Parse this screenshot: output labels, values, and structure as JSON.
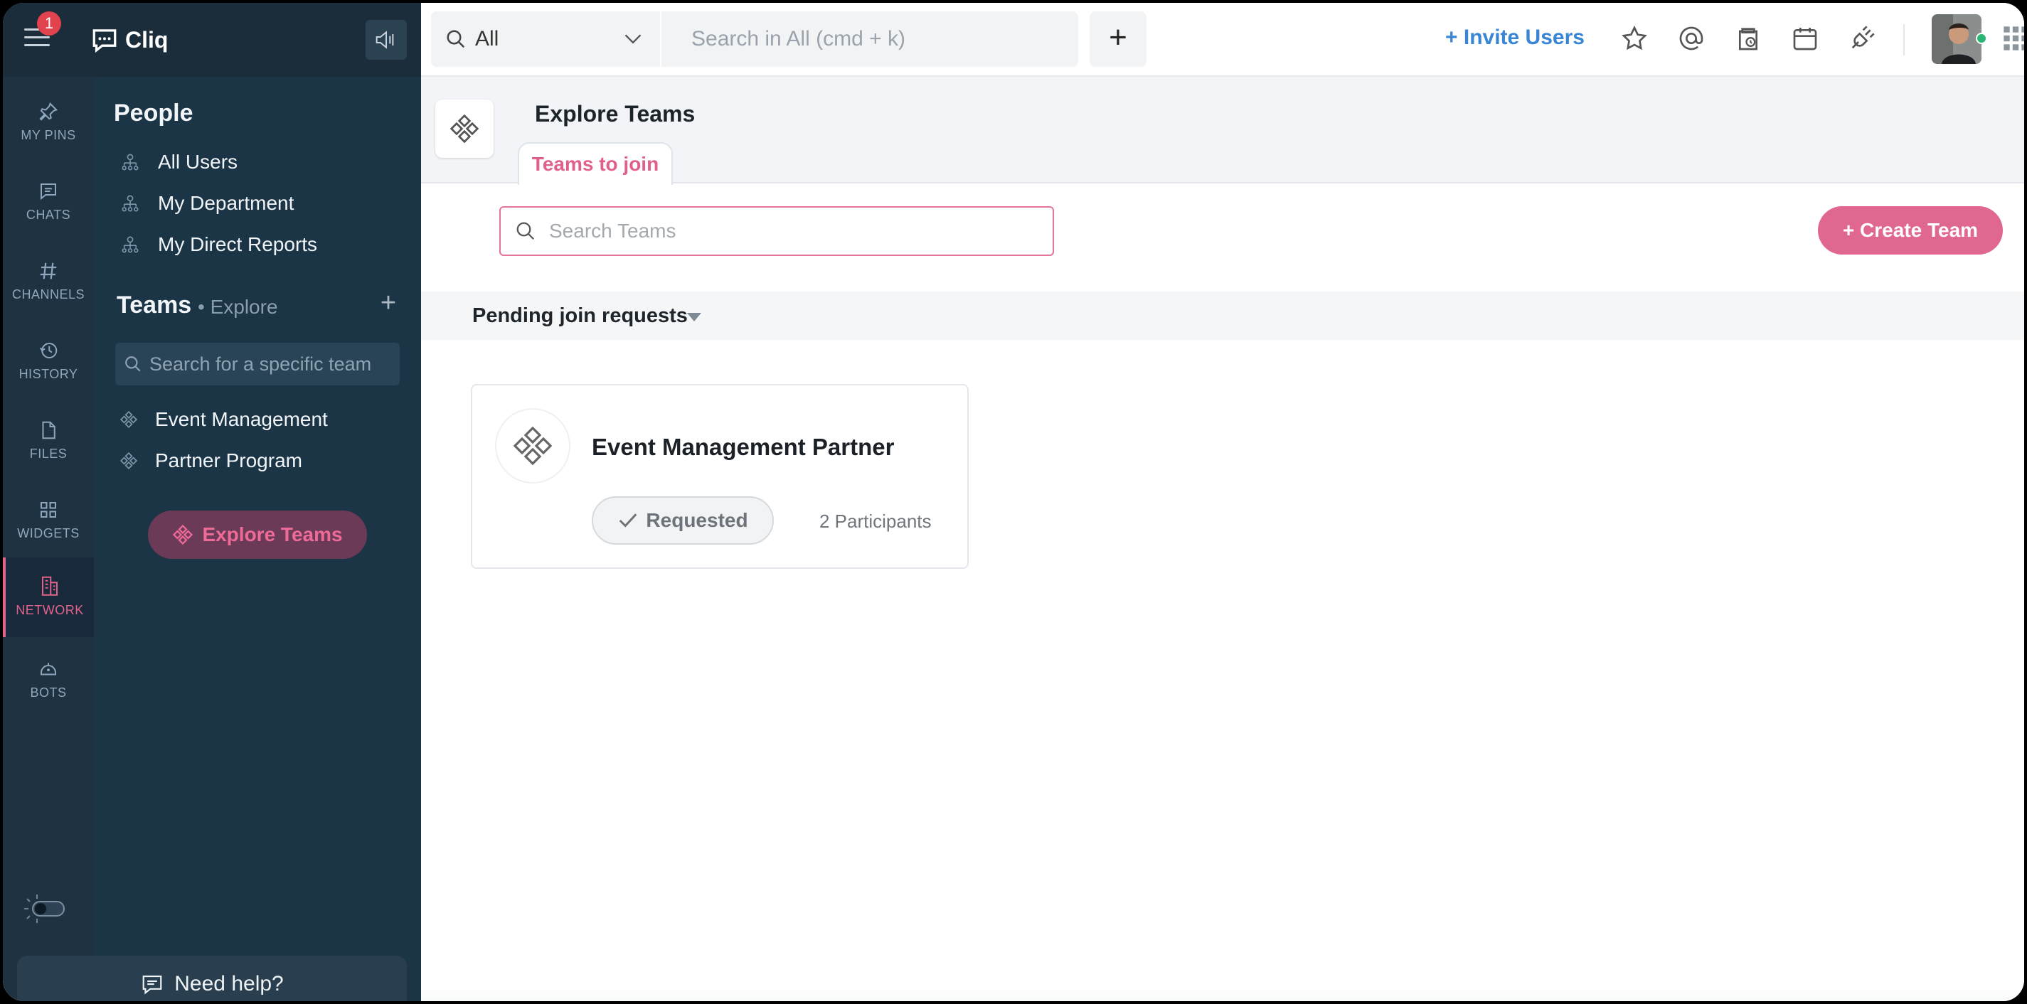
{
  "app": {
    "name": "Cliq",
    "notification_count": "1"
  },
  "rail": {
    "items": [
      {
        "label": "MY PINS",
        "icon": "pin-icon"
      },
      {
        "label": "CHATS",
        "icon": "chat-icon"
      },
      {
        "label": "CHANNELS",
        "icon": "hash-icon"
      },
      {
        "label": "HISTORY",
        "icon": "history-icon"
      },
      {
        "label": "FILES",
        "icon": "file-icon"
      },
      {
        "label": "WIDGETS",
        "icon": "widgets-icon"
      },
      {
        "label": "NETWORK",
        "icon": "network-icon",
        "active": true
      },
      {
        "label": "BOTS",
        "icon": "bot-icon"
      }
    ]
  },
  "sidebar": {
    "people_heading": "People",
    "people_links": [
      "All Users",
      "My Department",
      "My Direct Reports"
    ],
    "teams_heading": "Teams",
    "teams_explore": "• Explore",
    "team_search_placeholder": "Search for a specific team",
    "teams": [
      "Event Management",
      "Partner Program"
    ],
    "explore_button": "Explore Teams",
    "help_label": "Need help?"
  },
  "topbar": {
    "scope_value": "All",
    "search_placeholder": "Search in All (cmd + k)",
    "new_label": "+",
    "invite_label": "+ Invite Users",
    "icons": [
      "star-icon",
      "mention-icon",
      "reminder-icon",
      "calendar-icon",
      "integrations-icon",
      "apps-grid-icon"
    ]
  },
  "main": {
    "title": "Explore Teams",
    "tab_label": "Teams to join",
    "search_placeholder": "Search Teams",
    "create_button": "+ Create Team",
    "pending_label": "Pending join requests",
    "card": {
      "title": "Event Management Partner",
      "status_button": "Requested",
      "participants": "2 Participants"
    }
  },
  "colors": {
    "accent": "#e0678f",
    "rail_bg": "#1f3241",
    "sidebar_bg": "#1b3446",
    "link_blue": "#3a86d4"
  }
}
